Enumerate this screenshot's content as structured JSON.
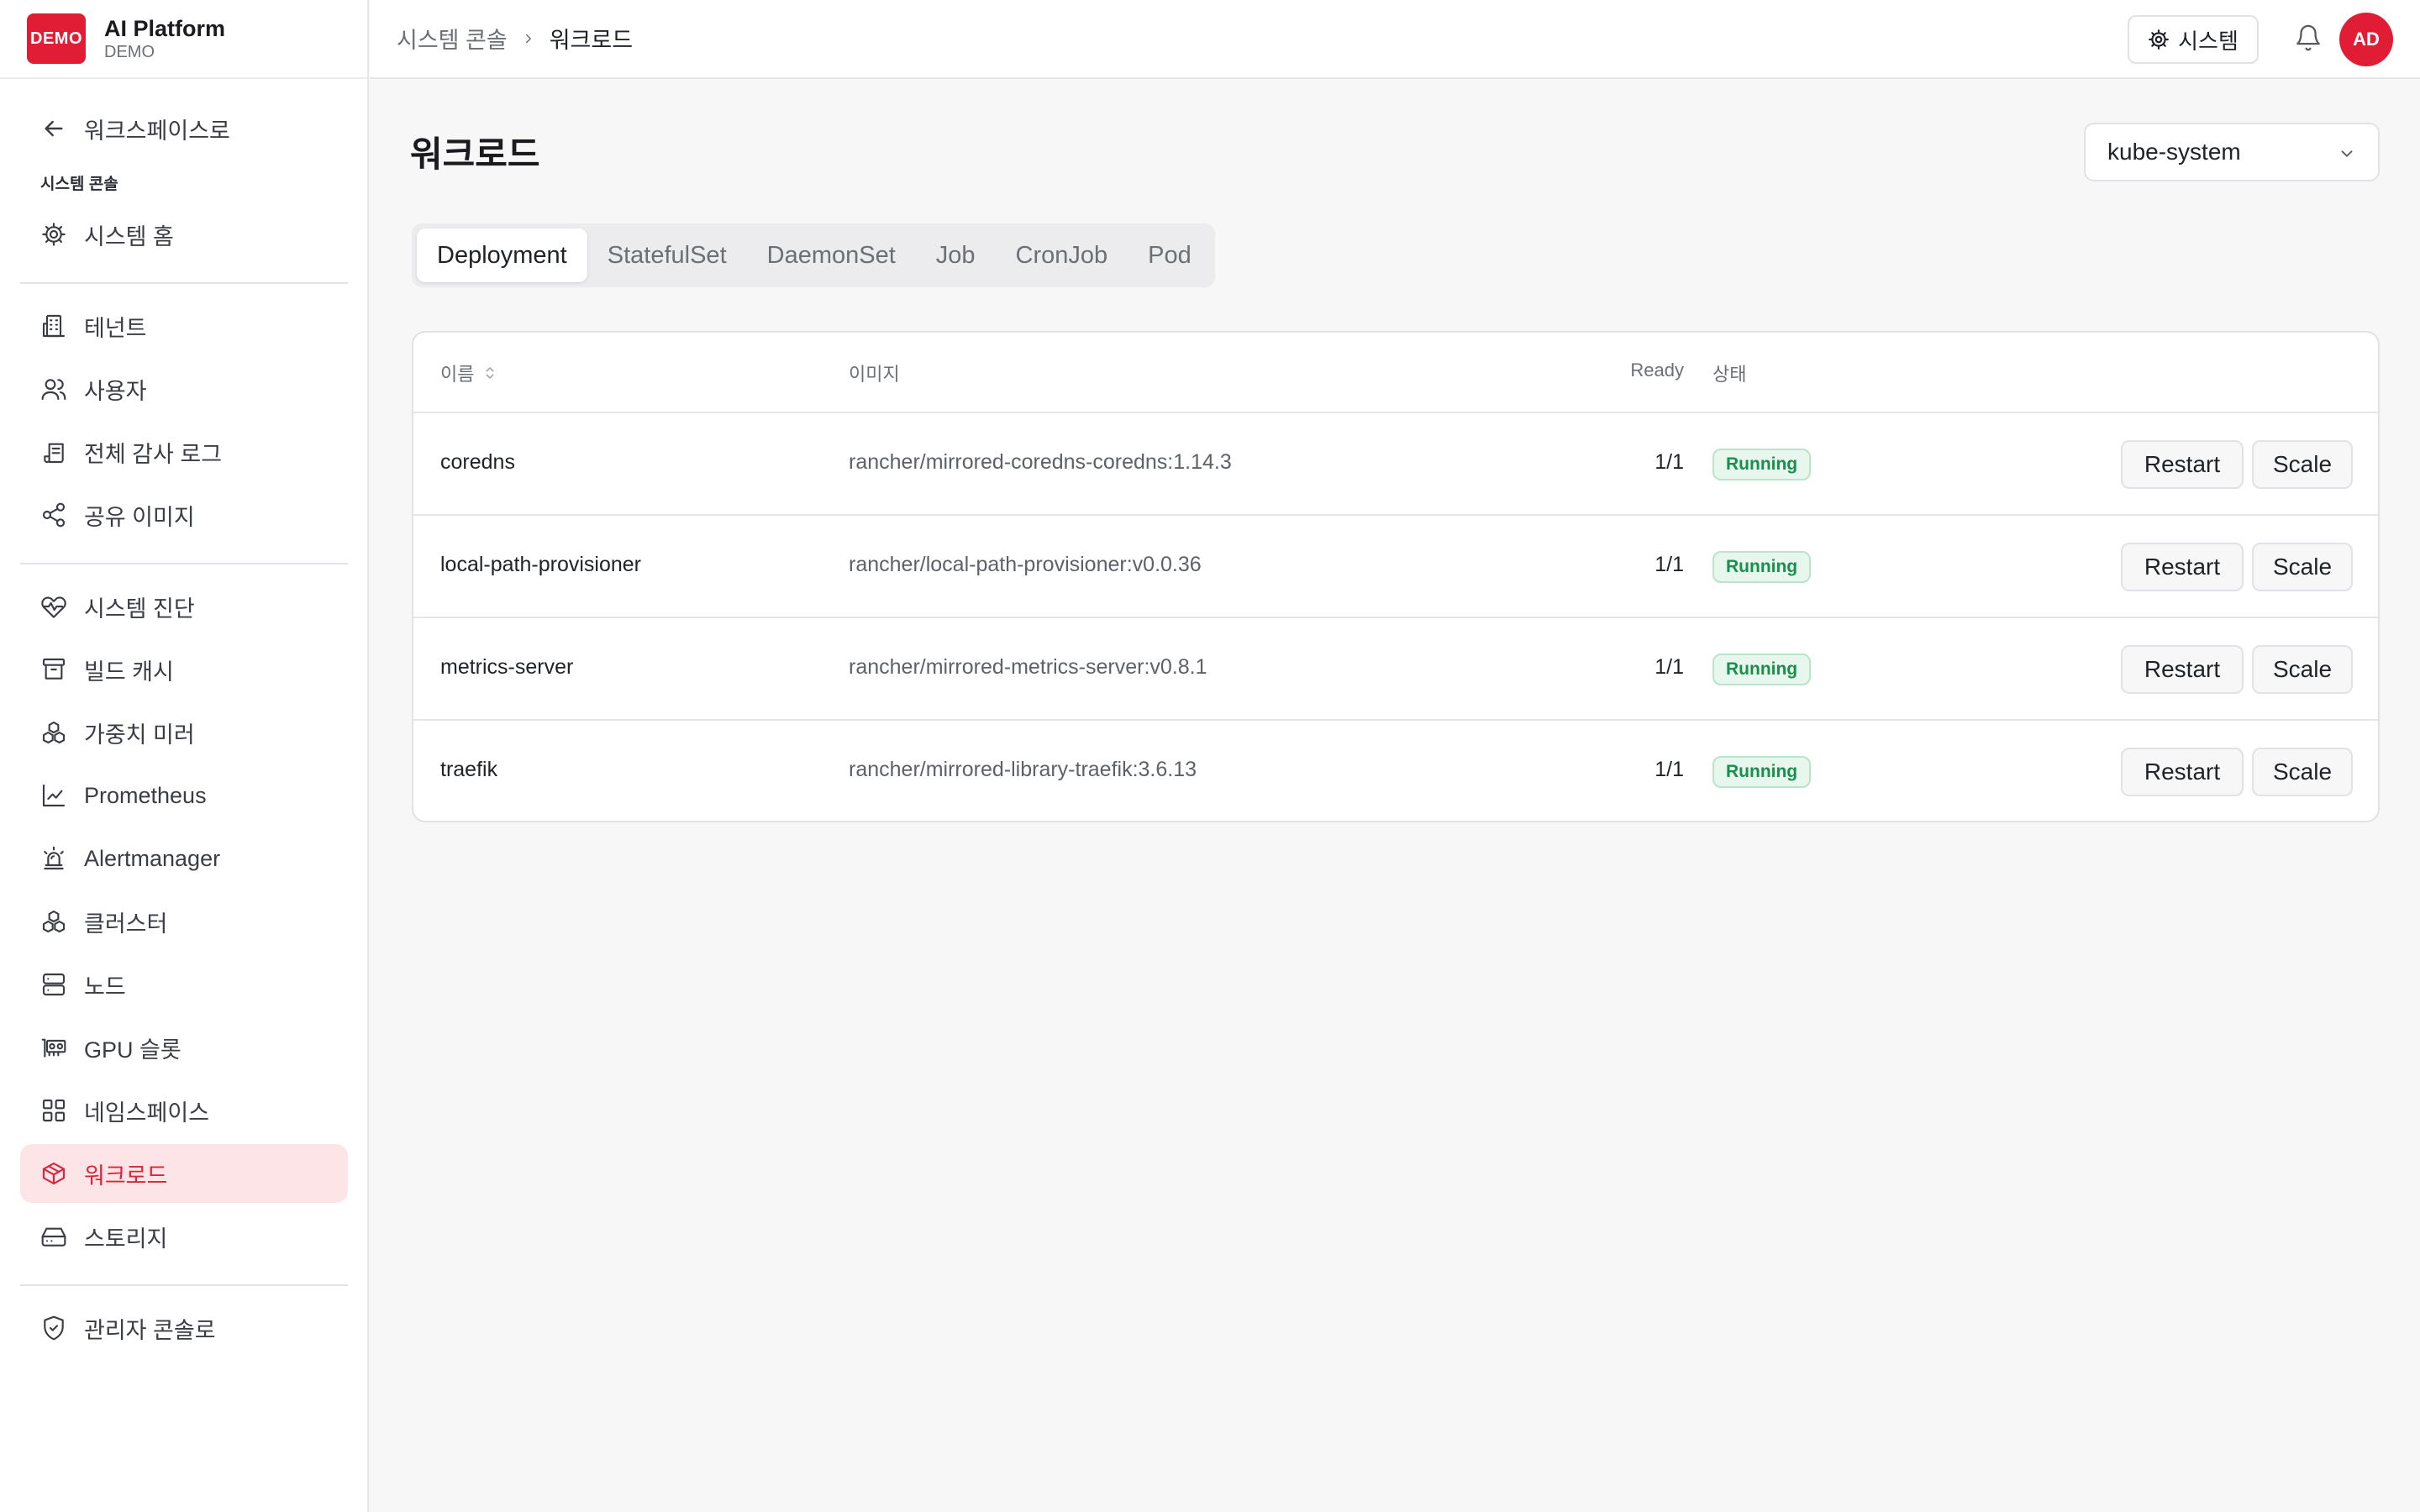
{
  "brand": {
    "logo": "DEMO",
    "title": "AI Platform",
    "subtitle": "DEMO"
  },
  "sidebar": {
    "back": "워크스페이스로",
    "section": "시스템 콘솔",
    "items": [
      {
        "label": "시스템 홈",
        "icon": "gear-icon"
      },
      {
        "label": "테넌트",
        "icon": "building-icon"
      },
      {
        "label": "사용자",
        "icon": "users-icon"
      },
      {
        "label": "전체 감사 로그",
        "icon": "scroll-icon"
      },
      {
        "label": "공유 이미지",
        "icon": "share-icon"
      },
      {
        "label": "시스템 진단",
        "icon": "heart-pulse-icon"
      },
      {
        "label": "빌드 캐시",
        "icon": "archive-icon"
      },
      {
        "label": "가중치 미러",
        "icon": "boxes-icon"
      },
      {
        "label": "Prometheus",
        "icon": "line-chart-icon"
      },
      {
        "label": "Alertmanager",
        "icon": "siren-icon"
      },
      {
        "label": "클러스터",
        "icon": "cluster-icon"
      },
      {
        "label": "노드",
        "icon": "server-icon"
      },
      {
        "label": "GPU 슬롯",
        "icon": "gpu-icon"
      },
      {
        "label": "네임스페이스",
        "icon": "grid-icon"
      },
      {
        "label": "워크로드",
        "icon": "package-icon"
      },
      {
        "label": "스토리지",
        "icon": "hard-drive-icon"
      },
      {
        "label": "관리자 콘솔로",
        "icon": "shield-icon"
      }
    ]
  },
  "topbar": {
    "breadcrumb": [
      "시스템 콘솔",
      "워크로드"
    ],
    "system_button": "시스템",
    "avatar": "AD"
  },
  "main": {
    "title": "워크로드",
    "namespace": "kube-system",
    "tabs": [
      "Deployment",
      "StatefulSet",
      "DaemonSet",
      "Job",
      "CronJob",
      "Pod"
    ],
    "active_tab": "Deployment",
    "table": {
      "headers": {
        "name": "이름",
        "image": "이미지",
        "ready": "Ready",
        "status": "상태"
      },
      "rows": [
        {
          "name": "coredns",
          "image": "rancher/mirrored-coredns-coredns:1.14.3",
          "ready": "1/1",
          "status": "Running",
          "restart": "Restart",
          "scale": "Scale"
        },
        {
          "name": "local-path-provisioner",
          "image": "rancher/local-path-provisioner:v0.0.36",
          "ready": "1/1",
          "status": "Running",
          "restart": "Restart",
          "scale": "Scale"
        },
        {
          "name": "metrics-server",
          "image": "rancher/mirrored-metrics-server:v0.8.1",
          "ready": "1/1",
          "status": "Running",
          "restart": "Restart",
          "scale": "Scale"
        },
        {
          "name": "traefik",
          "image": "rancher/mirrored-library-traefik:3.6.13",
          "ready": "1/1",
          "status": "Running",
          "restart": "Restart",
          "scale": "Scale"
        }
      ]
    }
  },
  "colors": {
    "accent": "#e11d36",
    "active_bg": "#fde4e7",
    "running": "#1a8f4d"
  }
}
